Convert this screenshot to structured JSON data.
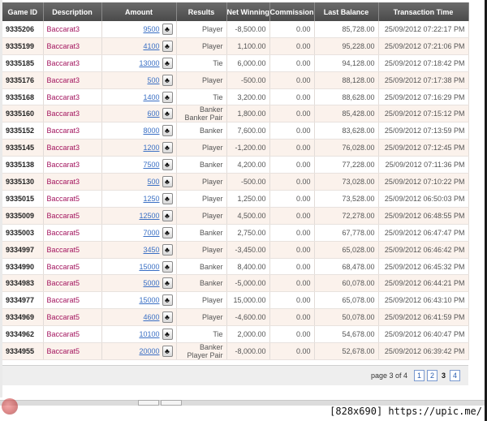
{
  "table": {
    "headers": [
      "Game ID",
      "Description",
      "Amount",
      "Results",
      "Net Winnings",
      "Commission",
      "Last Balance",
      "Transaction Time"
    ],
    "rows": [
      {
        "game_id": "9335206",
        "description": "Baccarat3",
        "amount": "9500",
        "results": [
          "Player"
        ],
        "net": "-8,500.00",
        "commission": "0.00",
        "balance": "85,728.00",
        "time": "25/09/2012 07:22:17 PM"
      },
      {
        "game_id": "9335199",
        "description": "Baccarat3",
        "amount": "4100",
        "results": [
          "Player"
        ],
        "net": "1,100.00",
        "commission": "0.00",
        "balance": "95,228.00",
        "time": "25/09/2012 07:21:06 PM"
      },
      {
        "game_id": "9335185",
        "description": "Baccarat3",
        "amount": "13000",
        "results": [
          "Tie"
        ],
        "net": "6,000.00",
        "commission": "0.00",
        "balance": "94,128.00",
        "time": "25/09/2012 07:18:42 PM"
      },
      {
        "game_id": "9335176",
        "description": "Baccarat3",
        "amount": "500",
        "results": [
          "Player"
        ],
        "net": "-500.00",
        "commission": "0.00",
        "balance": "88,128.00",
        "time": "25/09/2012 07:17:38 PM"
      },
      {
        "game_id": "9335168",
        "description": "Baccarat3",
        "amount": "1400",
        "results": [
          "Tie"
        ],
        "net": "3,200.00",
        "commission": "0.00",
        "balance": "88,628.00",
        "time": "25/09/2012 07:16:29 PM"
      },
      {
        "game_id": "9335160",
        "description": "Baccarat3",
        "amount": "600",
        "results": [
          "Banker",
          "Banker Pair"
        ],
        "net": "1,800.00",
        "commission": "0.00",
        "balance": "85,428.00",
        "time": "25/09/2012 07:15:12 PM"
      },
      {
        "game_id": "9335152",
        "description": "Baccarat3",
        "amount": "8000",
        "results": [
          "Banker"
        ],
        "net": "7,600.00",
        "commission": "0.00",
        "balance": "83,628.00",
        "time": "25/09/2012 07:13:59 PM"
      },
      {
        "game_id": "9335145",
        "description": "Baccarat3",
        "amount": "1200",
        "results": [
          "Player"
        ],
        "net": "-1,200.00",
        "commission": "0.00",
        "balance": "76,028.00",
        "time": "25/09/2012 07:12:45 PM"
      },
      {
        "game_id": "9335138",
        "description": "Baccarat3",
        "amount": "7500",
        "results": [
          "Banker"
        ],
        "net": "4,200.00",
        "commission": "0.00",
        "balance": "77,228.00",
        "time": "25/09/2012 07:11:36 PM"
      },
      {
        "game_id": "9335130",
        "description": "Baccarat3",
        "amount": "500",
        "results": [
          "Player"
        ],
        "net": "-500.00",
        "commission": "0.00",
        "balance": "73,028.00",
        "time": "25/09/2012 07:10:22 PM"
      },
      {
        "game_id": "9335015",
        "description": "Baccarat5",
        "amount": "1250",
        "results": [
          "Player"
        ],
        "net": "1,250.00",
        "commission": "0.00",
        "balance": "73,528.00",
        "time": "25/09/2012 06:50:03 PM"
      },
      {
        "game_id": "9335009",
        "description": "Baccarat5",
        "amount": "12500",
        "results": [
          "Player"
        ],
        "net": "4,500.00",
        "commission": "0.00",
        "balance": "72,278.00",
        "time": "25/09/2012 06:48:55 PM"
      },
      {
        "game_id": "9335003",
        "description": "Baccarat5",
        "amount": "7000",
        "results": [
          "Banker"
        ],
        "net": "2,750.00",
        "commission": "0.00",
        "balance": "67,778.00",
        "time": "25/09/2012 06:47:47 PM"
      },
      {
        "game_id": "9334997",
        "description": "Baccarat5",
        "amount": "3450",
        "results": [
          "Player"
        ],
        "net": "-3,450.00",
        "commission": "0.00",
        "balance": "65,028.00",
        "time": "25/09/2012 06:46:42 PM"
      },
      {
        "game_id": "9334990",
        "description": "Baccarat5",
        "amount": "15000",
        "results": [
          "Banker"
        ],
        "net": "8,400.00",
        "commission": "0.00",
        "balance": "68,478.00",
        "time": "25/09/2012 06:45:32 PM"
      },
      {
        "game_id": "9334983",
        "description": "Baccarat5",
        "amount": "5000",
        "results": [
          "Banker"
        ],
        "net": "-5,000.00",
        "commission": "0.00",
        "balance": "60,078.00",
        "time": "25/09/2012 06:44:21 PM"
      },
      {
        "game_id": "9334977",
        "description": "Baccarat5",
        "amount": "15000",
        "results": [
          "Player"
        ],
        "net": "15,000.00",
        "commission": "0.00",
        "balance": "65,078.00",
        "time": "25/09/2012 06:43:10 PM"
      },
      {
        "game_id": "9334969",
        "description": "Baccarat5",
        "amount": "4600",
        "results": [
          "Player"
        ],
        "net": "-4,600.00",
        "commission": "0.00",
        "balance": "50,078.00",
        "time": "25/09/2012 06:41:59 PM"
      },
      {
        "game_id": "9334962",
        "description": "Baccarat5",
        "amount": "10100",
        "results": [
          "Tie"
        ],
        "net": "2,000.00",
        "commission": "0.00",
        "balance": "54,678.00",
        "time": "25/09/2012 06:40:47 PM"
      },
      {
        "game_id": "9334955",
        "description": "Baccarat5",
        "amount": "20000",
        "results": [
          "Banker",
          "Player Pair"
        ],
        "net": "-8,000.00",
        "commission": "0.00",
        "balance": "52,678.00",
        "time": "25/09/2012 06:39:42 PM"
      }
    ],
    "card_icon": "club-card-icon",
    "card_glyph": "♣"
  },
  "pager": {
    "label": "page 3 of 4",
    "pages": [
      {
        "label": "1",
        "current": false
      },
      {
        "label": "2",
        "current": false
      },
      {
        "label": "3",
        "current": true
      },
      {
        "label": "4",
        "current": false
      }
    ]
  },
  "watermark": "[828x690] https://upic.me/",
  "colors": {
    "header_bg": "#5a5a5a",
    "row_alt_bg": "#fbf2ec",
    "description_text": "#a3145e",
    "link_blue": "#3a6fc4"
  }
}
